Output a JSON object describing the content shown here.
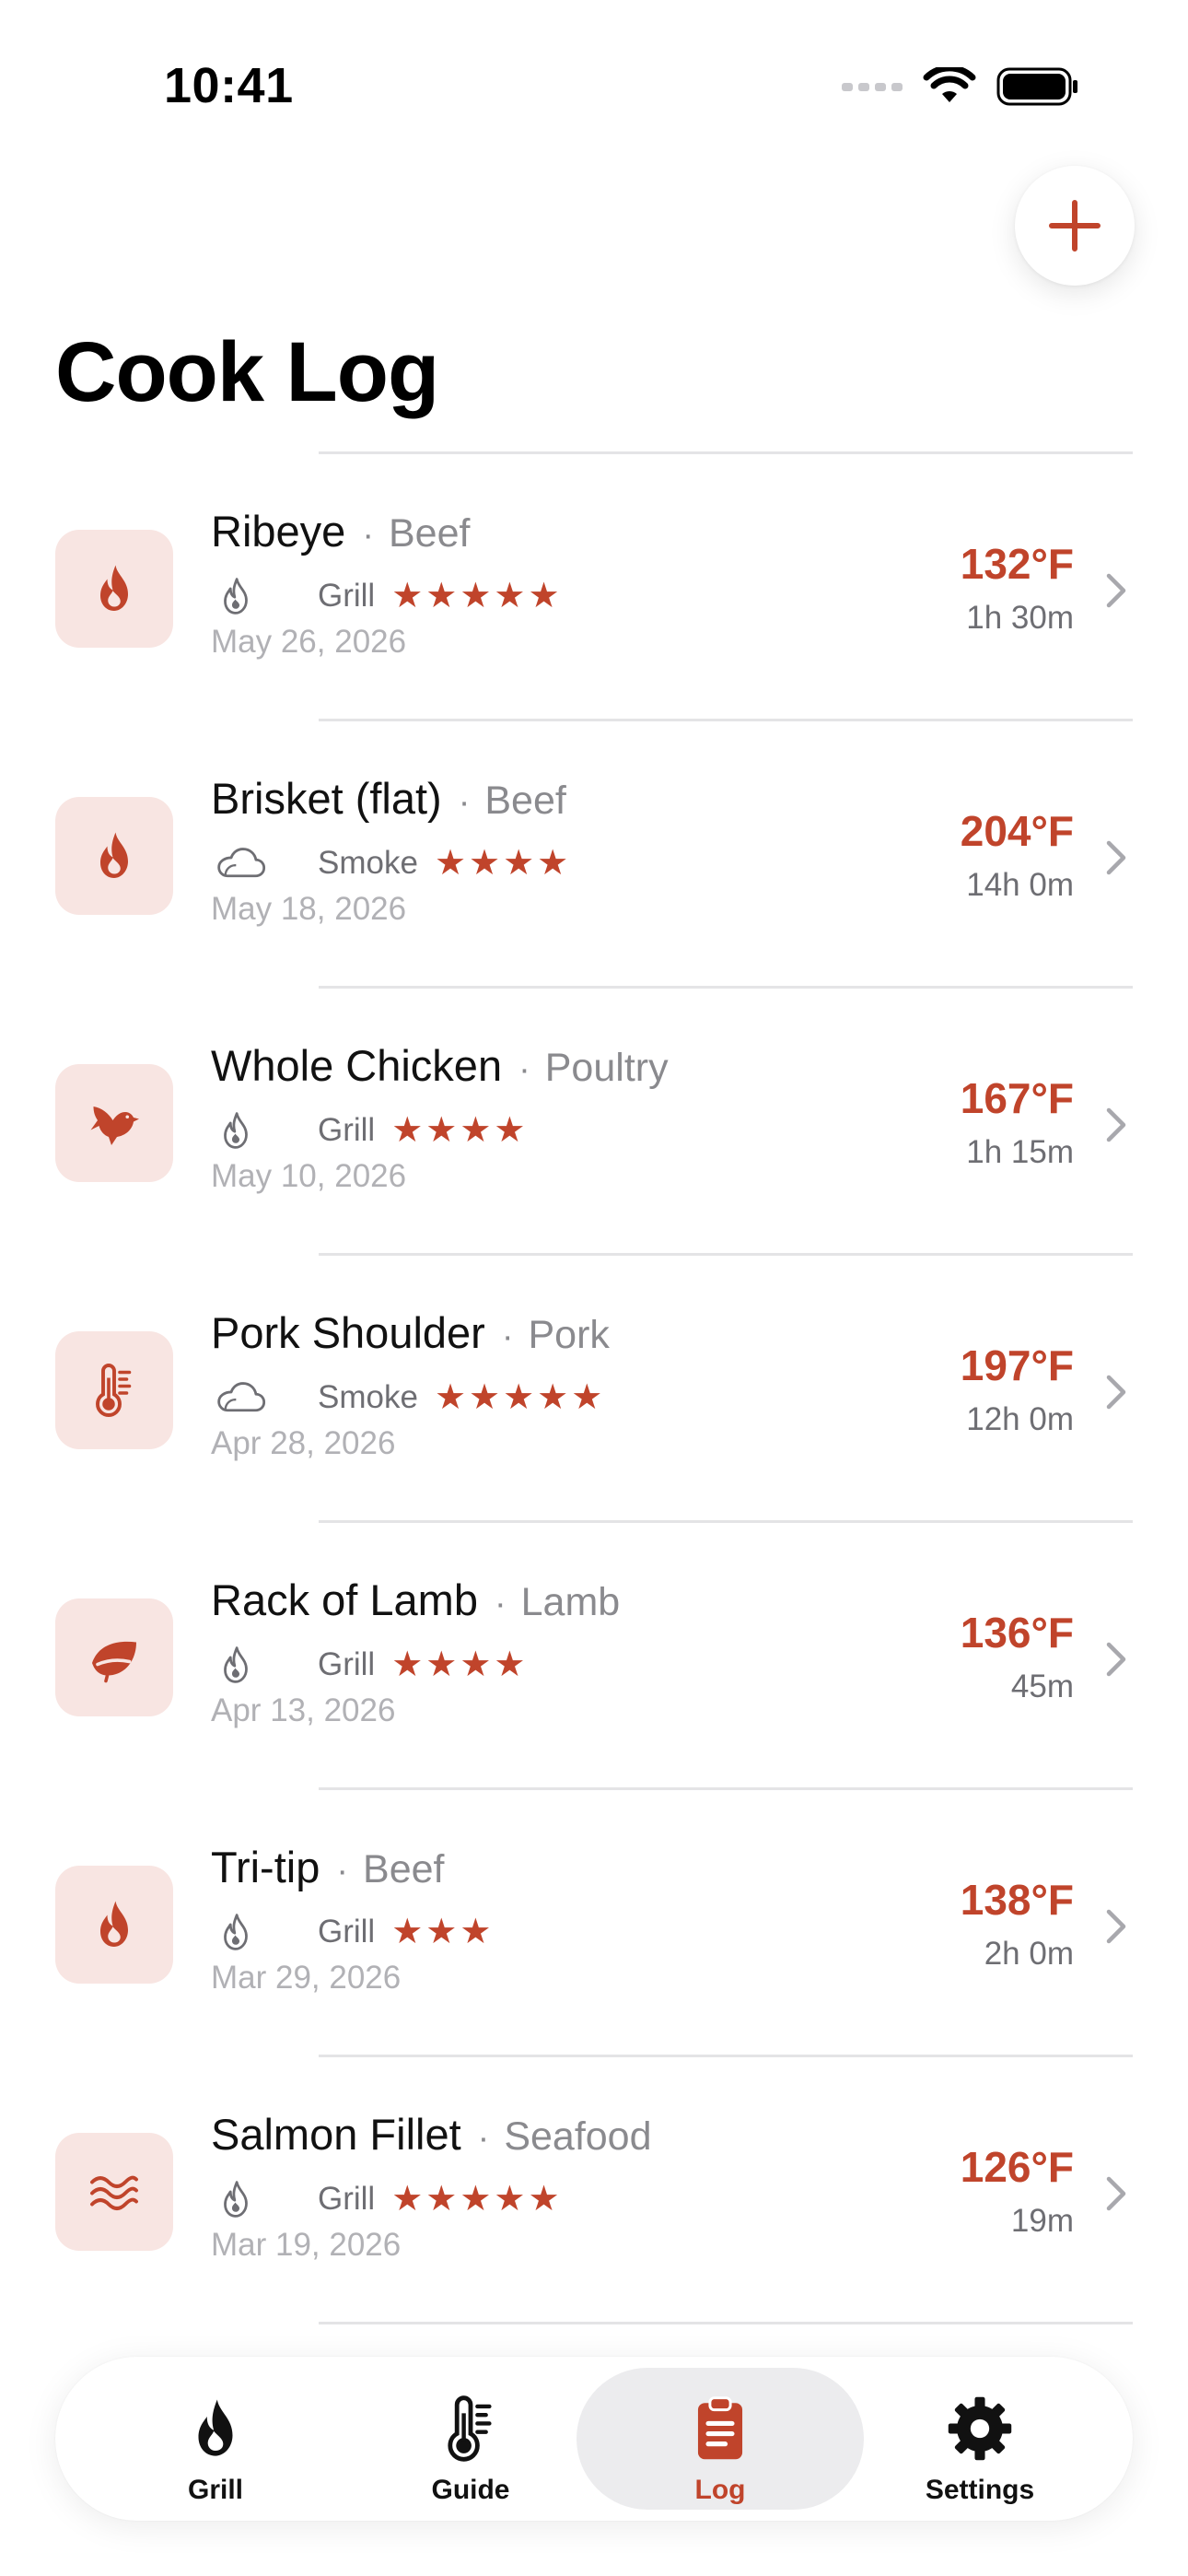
{
  "status_bar": {
    "time": "10:41"
  },
  "page": {
    "title": "Cook Log"
  },
  "colors": {
    "accent": "#C0442B",
    "icon_bg": "#F8E5E2",
    "divider": "#E4E4E6",
    "secondary_text": "#8A8A8E",
    "date_text": "#B1B1B5"
  },
  "cooks": [
    {
      "name": "Ribeye",
      "category": "Beef",
      "method": "Grill",
      "method_icon": "flame-outline-icon",
      "stars": "★★★★★",
      "rating": 5,
      "date": "May 26, 2026",
      "temp": "132°F",
      "duration": "1h 30m",
      "icon": "flame-icon"
    },
    {
      "name": "Brisket (flat)",
      "category": "Beef",
      "method": "Smoke",
      "method_icon": "cloud-icon",
      "stars": "★★★★",
      "rating": 4,
      "date": "May 18, 2026",
      "temp": "204°F",
      "duration": "14h 0m",
      "icon": "flame-icon"
    },
    {
      "name": "Whole Chicken",
      "category": "Poultry",
      "method": "Grill",
      "method_icon": "flame-outline-icon",
      "stars": "★★★★",
      "rating": 4,
      "date": "May 10, 2026",
      "temp": "167°F",
      "duration": "1h 15m",
      "icon": "bird-icon"
    },
    {
      "name": "Pork Shoulder",
      "category": "Pork",
      "method": "Smoke",
      "method_icon": "cloud-icon",
      "stars": "★★★★★",
      "rating": 5,
      "date": "Apr 28, 2026",
      "temp": "197°F",
      "duration": "12h 0m",
      "icon": "thermometer-icon"
    },
    {
      "name": "Rack of Lamb",
      "category": "Lamb",
      "method": "Grill",
      "method_icon": "flame-outline-icon",
      "stars": "★★★★",
      "rating": 4,
      "date": "Apr 13, 2026",
      "temp": "136°F",
      "duration": "45m",
      "icon": "leaf-icon"
    },
    {
      "name": "Tri-tip",
      "category": "Beef",
      "method": "Grill",
      "method_icon": "flame-outline-icon",
      "stars": "★★★",
      "rating": 3,
      "date": "Mar 29, 2026",
      "temp": "138°F",
      "duration": "2h 0m",
      "icon": "flame-icon"
    },
    {
      "name": "Salmon Fillet",
      "category": "Seafood",
      "method": "Grill",
      "method_icon": "flame-outline-icon",
      "stars": "★★★★★",
      "rating": 5,
      "date": "Mar 19, 2026",
      "temp": "126°F",
      "duration": "19m",
      "icon": "waves-icon"
    }
  ],
  "tabs": [
    {
      "label": "Grill",
      "icon": "flame-icon",
      "active": false
    },
    {
      "label": "Guide",
      "icon": "thermometer-icon",
      "active": false
    },
    {
      "label": "Log",
      "icon": "clipboard-icon",
      "active": true
    },
    {
      "label": "Settings",
      "icon": "gear-icon",
      "active": false
    }
  ]
}
